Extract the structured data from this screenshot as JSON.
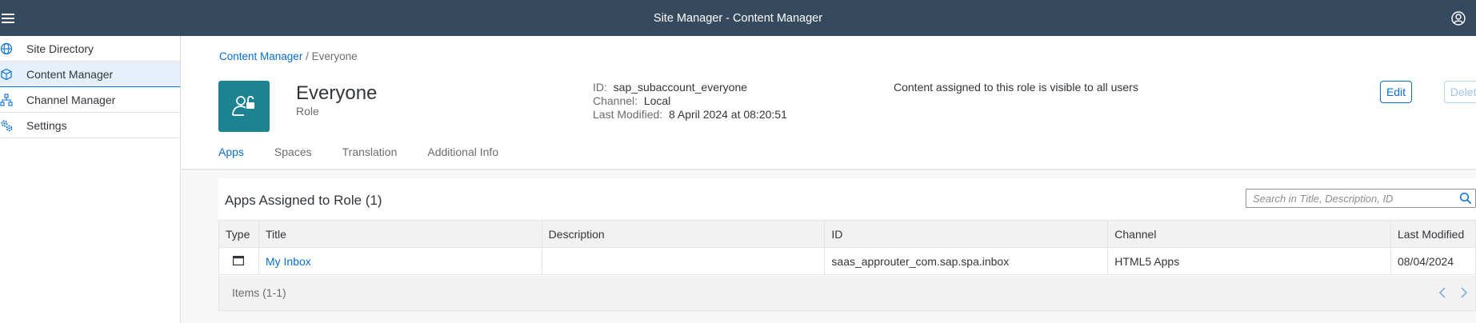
{
  "shell": {
    "title": "Site Manager - Content Manager"
  },
  "sidebar": {
    "items": [
      {
        "label": "Site Directory",
        "icon": "globe-icon"
      },
      {
        "label": "Content Manager",
        "icon": "cube-icon",
        "active": true
      },
      {
        "label": "Channel Manager",
        "icon": "network-icon"
      },
      {
        "label": "Settings",
        "icon": "gear-icon"
      }
    ]
  },
  "breadcrumb": {
    "link": "Content Manager",
    "separator": "/",
    "current": "Everyone"
  },
  "header": {
    "title": "Everyone",
    "subtitle": "Role",
    "id_label": "ID:",
    "id_value": "sap_subaccount_everyone",
    "channel_label": "Channel:",
    "channel_value": "Local",
    "modified_label": "Last Modified:",
    "modified_value": "8 April 2024 at 08:20:51",
    "notice": "Content assigned to this role is visible to all users",
    "edit_label": "Edit",
    "delete_label": "Delete"
  },
  "tabs": [
    "Apps",
    "Spaces",
    "Translation",
    "Additional Info"
  ],
  "apps": {
    "title": "Apps Assigned to Role (1)",
    "search_placeholder": "Search in Title, Description, ID",
    "columns": [
      "Type",
      "Title",
      "Description",
      "ID",
      "Channel",
      "Last Modified"
    ],
    "rows": [
      {
        "type_icon": "window-icon",
        "title": "My Inbox",
        "description": "",
        "id": "saas_approuter_com.sap.spa.inbox",
        "channel": "HTML5 Apps",
        "last_modified": "08/04/2024"
      }
    ],
    "footer": "Items (1-1)"
  },
  "colors": {
    "shell": "#354a5f",
    "accent": "#0a6ed1",
    "role_avatar": "#1d8292"
  }
}
